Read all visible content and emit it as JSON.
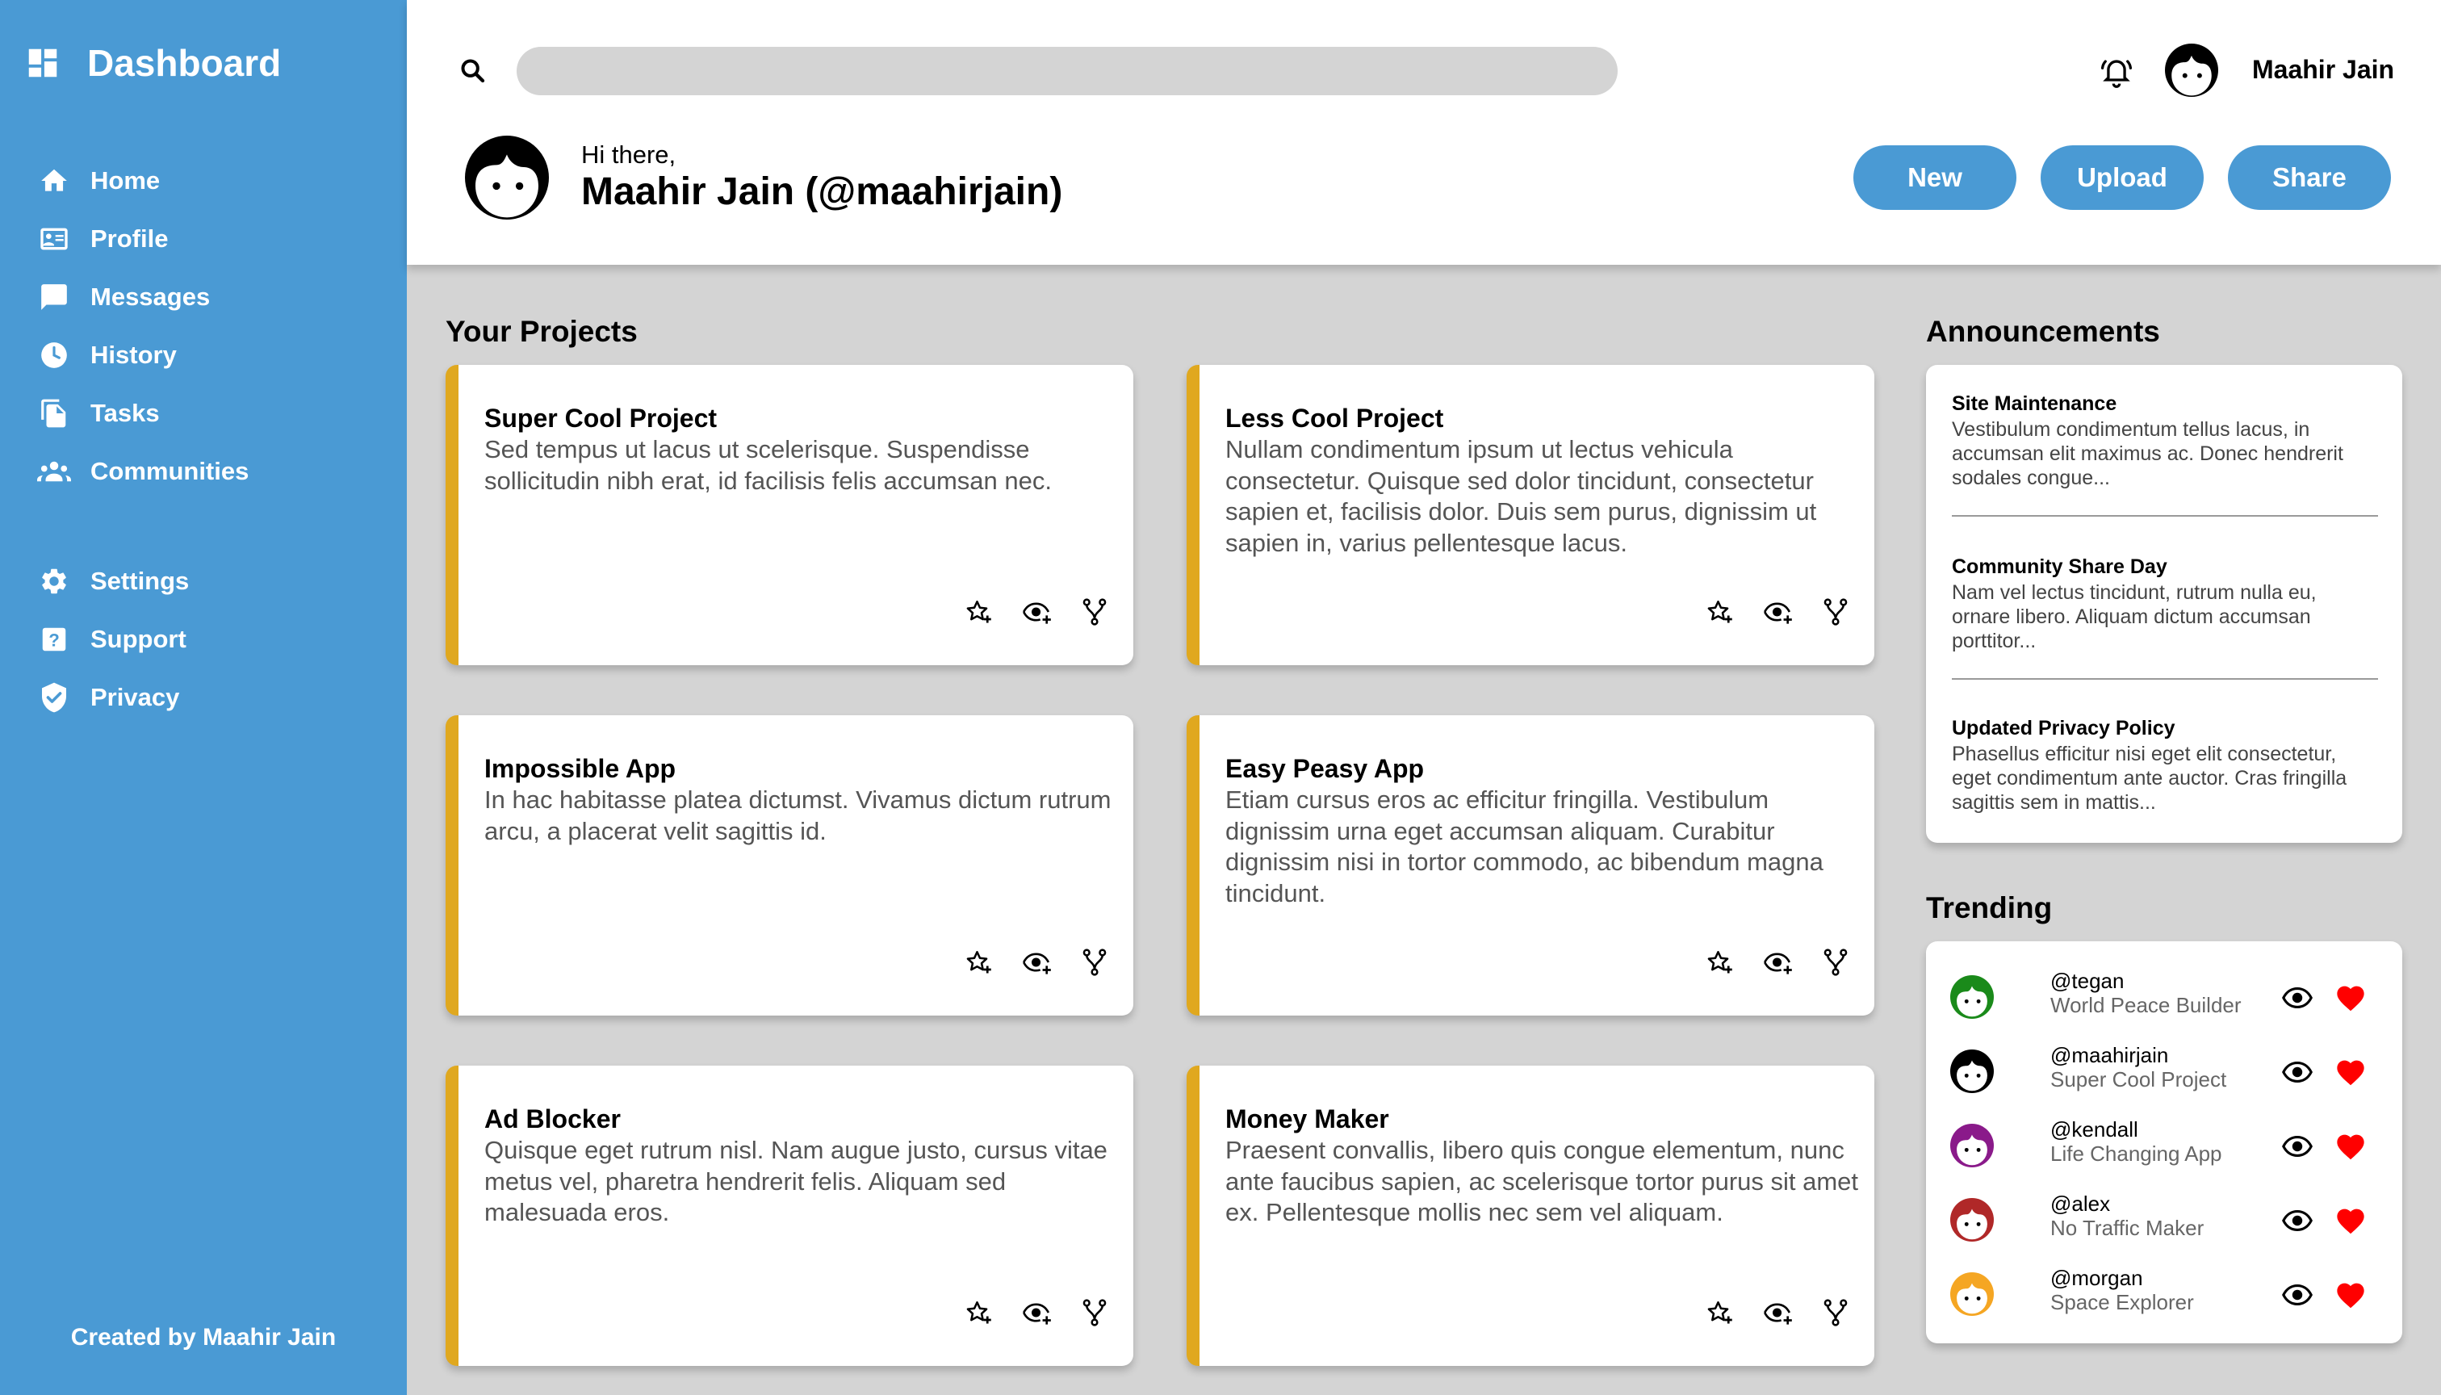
{
  "sidebar": {
    "title": "Dashboard",
    "nav": [
      {
        "label": "Home",
        "icon": "home-icon"
      },
      {
        "label": "Profile",
        "icon": "profile-card-icon"
      },
      {
        "label": "Messages",
        "icon": "message-icon"
      },
      {
        "label": "History",
        "icon": "clock-icon"
      },
      {
        "label": "Tasks",
        "icon": "document-icon"
      },
      {
        "label": "Communities",
        "icon": "people-icon"
      }
    ],
    "nav_secondary": [
      {
        "label": "Settings",
        "icon": "gear-icon"
      },
      {
        "label": "Support",
        "icon": "help-icon"
      },
      {
        "label": "Privacy",
        "icon": "shield-icon"
      }
    ],
    "credit": "Created by Maahir Jain"
  },
  "header": {
    "search_placeholder": "",
    "user_name": "Maahir Jain",
    "greeting": "Hi there,",
    "user_full": "Maahir Jain (@maahirjain)",
    "buttons": {
      "new": "New",
      "upload": "Upload",
      "share": "Share"
    }
  },
  "projects": {
    "title": "Your Projects",
    "items": [
      {
        "title": "Super Cool Project",
        "desc": "Sed tempus ut lacus ut scelerisque. Suspendisse sollicitudin nibh erat, id facilisis felis accumsan nec."
      },
      {
        "title": "Less Cool Project",
        "desc": "Nullam condimentum ipsum ut lectus vehicula consectetur. Quisque sed dolor tincidunt, consectetur sapien et, facilisis dolor. Duis sem purus, dignissim ut sapien in, varius pellentesque lacus."
      },
      {
        "title": "Impossible App",
        "desc": "In hac habitasse platea dictumst. Vivamus dictum rutrum arcu, a placerat velit sagittis id."
      },
      {
        "title": "Easy Peasy App",
        "desc": "Etiam cursus eros ac efficitur fringilla. Vestibulum dignissim urna eget accumsan aliquam. Curabitur dignissim nisi in tortor commodo, ac bibendum magna tincidunt."
      },
      {
        "title": "Ad Blocker",
        "desc": "Quisque eget rutrum nisl. Nam augue justo, cursus vitae metus vel, pharetra hendrerit felis. Aliquam sed malesuada eros."
      },
      {
        "title": "Money Maker",
        "desc": "Praesent convallis, libero quis congue elementum, nunc ante faucibus sapien, ac scelerisque tortor purus sit amet ex. Pellentesque mollis nec sem vel aliquam."
      }
    ]
  },
  "announcements": {
    "title": "Announcements",
    "items": [
      {
        "title": "Site Maintenance",
        "text": "Vestibulum condimentum tellus lacus, in accumsan elit maximus ac. Donec hendrerit sodales congue..."
      },
      {
        "title": "Community Share Day",
        "text": "Nam vel lectus tincidunt, rutrum nulla eu, ornare libero. Aliquam dictum accumsan porttitor..."
      },
      {
        "title": "Updated Privacy Policy",
        "text": "Phasellus efficitur nisi eget elit consectetur, eget condimentum ante auctor. Cras fringilla sagittis sem in mattis..."
      }
    ]
  },
  "trending": {
    "title": "Trending",
    "items": [
      {
        "handle": "@tegan",
        "project": "World Peace Builder",
        "color": "#1a8a1a"
      },
      {
        "handle": "@maahirjain",
        "project": "Super Cool Project",
        "color": "#000000"
      },
      {
        "handle": "@kendall",
        "project": "Life Changing App",
        "color": "#8a1a8a"
      },
      {
        "handle": "@alex",
        "project": "No Traffic Maker",
        "color": "#b02828"
      },
      {
        "handle": "@morgan",
        "project": "Space Explorer",
        "color": "#f5a623"
      }
    ]
  },
  "colors": {
    "sidebar": "#4a9ad4",
    "accent": "#4a9ad4",
    "card_border": "#e0a81f",
    "heart": "#ff0000",
    "background": "#d4d4d4"
  }
}
